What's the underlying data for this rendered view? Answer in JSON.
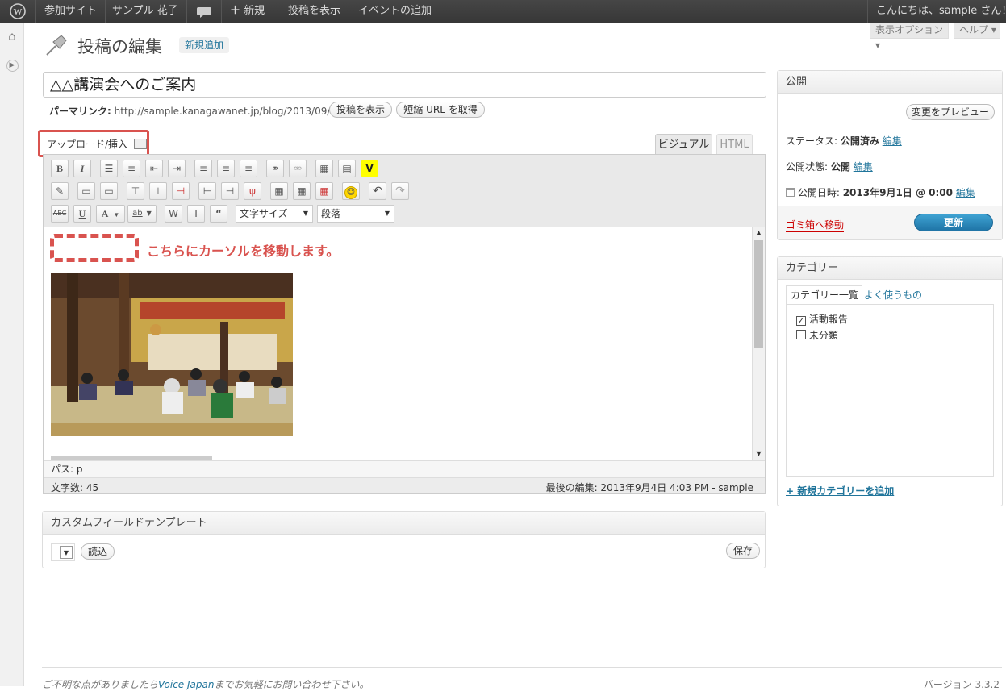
{
  "adminbar": {
    "logo": "wordpress-icon",
    "site_link": "参加サイト",
    "user_name": "サンプル 花子",
    "comment_icon": "comment-icon",
    "new_label": "新規",
    "view_post": "投稿を表示",
    "add_event": "イベントの追加",
    "greeting": "こんにちは、sample さん！"
  },
  "header": {
    "screen_options": "表示オプション",
    "help": "ヘルプ",
    "page_title": "投稿の編集",
    "add_new": "新規追加"
  },
  "post": {
    "title": "△△講演会へのご案内",
    "permalink_label": "パーマリンク:",
    "permalink_url": "http://sample.kanagawanet.jp/blog/2013/09/01/2/",
    "view_button": "投稿を表示",
    "shortlink_button": "短縮 URL を取得"
  },
  "editor": {
    "upload_label": "アップロード/挿入",
    "tab_visual": "ビジュアル",
    "tab_html": "HTML",
    "font_size_select": "文字サイズ",
    "format_select": "段落",
    "annotation": "こちらにカーソルを移動します。",
    "path": "パス: p",
    "word_count": "文字数: 45",
    "last_edit": "最後の編集: 2013年9月4日 4:03 PM - sample",
    "annotation_color": "#d9534f"
  },
  "custom_field": {
    "title": "カスタムフィールドテンプレート",
    "load_button": "読込",
    "save_button": "保存"
  },
  "publish": {
    "title": "公開",
    "preview_button": "変更をプレビュー",
    "status_label": "ステータス:",
    "status_value": "公開済み",
    "visibility_label": "公開状態:",
    "visibility_value": "公開",
    "date_label": "公開日時:",
    "date_value": "2013年9月1日 @ 0:00",
    "edit_link": "編集",
    "trash_link": "ゴミ箱へ移動",
    "update_button": "更新"
  },
  "categories": {
    "title": "カテゴリー",
    "tab_all": "カテゴリー一覧",
    "tab_popular": "よく使うもの",
    "items": [
      {
        "label": "活動報告",
        "checked": true
      },
      {
        "label": "未分類",
        "checked": false
      }
    ],
    "add_new": "+ 新規カテゴリーを追加"
  },
  "footer": {
    "text_before": "ご不明な点がありましたら",
    "link": "Voice Japan",
    "text_after": "までお気軽にお問い合わせ下さい。",
    "version": "バージョン 3.3.2"
  }
}
